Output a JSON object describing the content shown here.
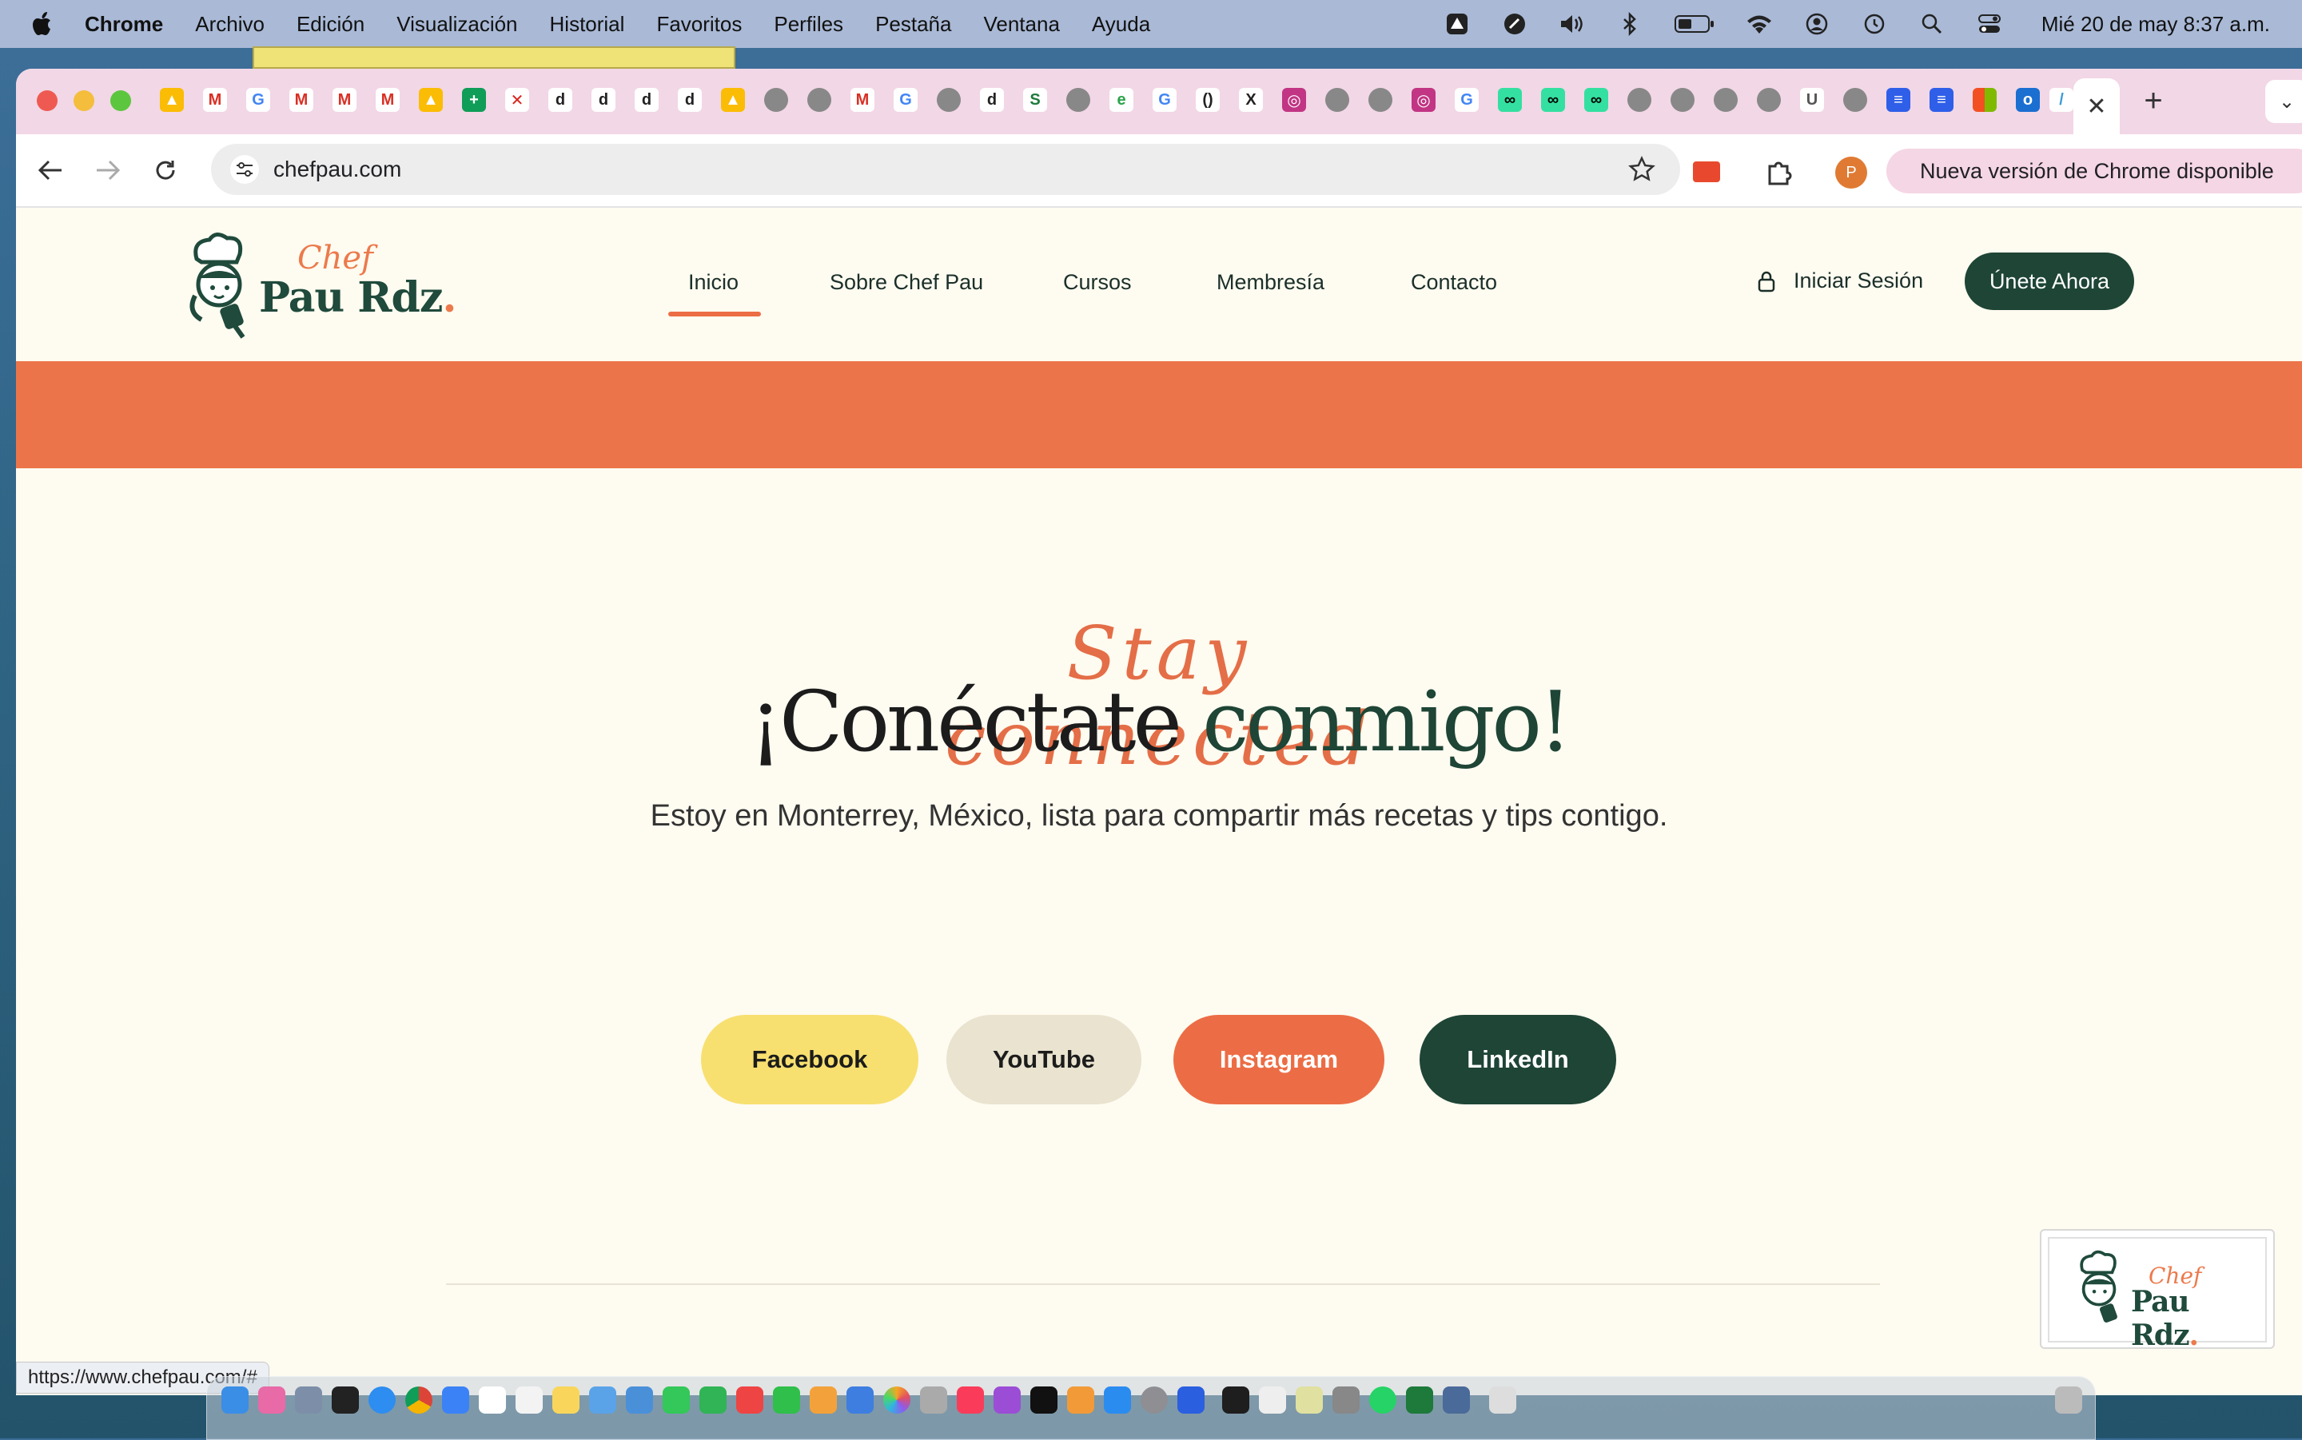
{
  "menubar": {
    "app": "Chrome",
    "items": [
      "Archivo",
      "Edición",
      "Visualización",
      "Historial",
      "Favoritos",
      "Perfiles",
      "Pestaña",
      "Ventana",
      "Ayuda"
    ],
    "clock": "Mié 20 de may  8:37 a.m."
  },
  "browser": {
    "active_tab_close": "✕",
    "new_tab": "+",
    "url": "chefpau.com",
    "profile_initial": "P",
    "update_chip": "Nueva versión de Chrome disponible",
    "status_url": "https://www.chefpau.com/#"
  },
  "site": {
    "logo": {
      "chef": "Chef",
      "name": "Pau Rdz",
      "dot": "."
    },
    "nav": [
      "Inicio",
      "Sobre Chef Pau",
      "Cursos",
      "Membresía",
      "Contacto"
    ],
    "active_nav": "Inicio",
    "login": "Iniciar Sesión",
    "join": "Únete Ahora",
    "hero": {
      "script": "Stay connected",
      "title_a": "¡Conéctate ",
      "title_b": "conmigo!",
      "subtitle": "Estoy en Monterrey, México, lista para compartir más recetas y tips contigo."
    },
    "social": [
      "Facebook",
      "YouTube",
      "Instagram",
      "LinkedIn"
    ]
  },
  "colors": {
    "brand_orange": "#ec744b",
    "brand_green": "#1e4536",
    "facebook_bg": "#f8e070",
    "youtube_bg": "#e9e3cf",
    "page_bg": "#fefbf0"
  }
}
